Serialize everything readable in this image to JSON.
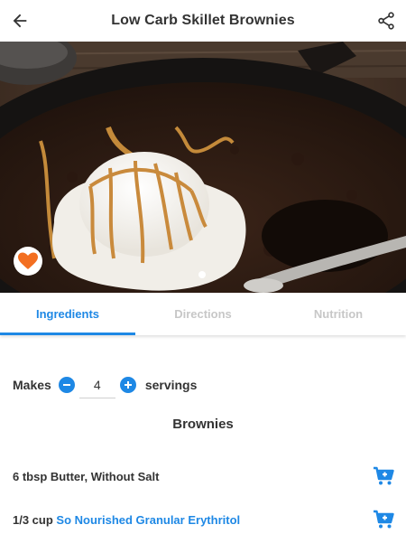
{
  "header": {
    "title": "Low Carb Skillet Brownies",
    "back_icon": "arrow-back-icon",
    "share_icon": "share-icon"
  },
  "hero": {
    "favorite_icon": "heart-icon",
    "favorite_color": "#f36f21",
    "carousel_pages": 1,
    "carousel_current": 1
  },
  "tabs": [
    {
      "label": "Ingredients",
      "active": true
    },
    {
      "label": "Directions",
      "active": false
    },
    {
      "label": "Nutrition",
      "active": false
    }
  ],
  "servings": {
    "makes_label": "Makes",
    "quantity": "4",
    "unit_label": "servings"
  },
  "section_title": "Brownies",
  "ingredients": [
    {
      "amount": "6 tbsp",
      "name": "Butter, Without Salt",
      "linked": false
    },
    {
      "amount": "1/3 cup",
      "name": "So Nourished Granular Erythritol",
      "linked": true
    }
  ],
  "colors": {
    "accent": "#1e88e5",
    "text": "#333333",
    "inactive_tab": "#c7c7c7",
    "favorite": "#f36f21"
  }
}
